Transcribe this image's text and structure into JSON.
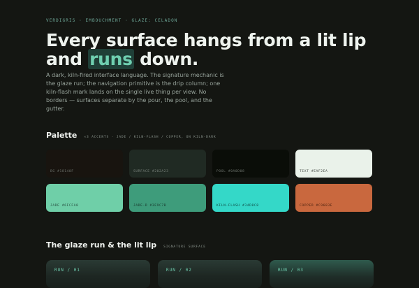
{
  "eyebrow": "VERDIGRIS · EMBOUCHMENT · GLAZE: CELADON",
  "headline": {
    "main": "Every surface hangs from a lit lip and ",
    "accent": "runs",
    "tail": " down."
  },
  "lede": "A dark, kiln-fired interface language. The signature mechanic is the glaze run; the navigation primitive is the drip column; one kiln-flash mark lands on the single live thing per view. No borders — surfaces separate by the pour, the pool, and the gutter.",
  "palette": {
    "title": "Palette",
    "subtitle": "×3 ACCENTS · JADE / KILN-FLASH / COPPER, ON KILN-DARK",
    "swatches": [
      {
        "label": "BG #18140F",
        "color": "#18140f",
        "text_color": "#6f756f"
      },
      {
        "label": "SURFACE #202A23",
        "color": "#202a23",
        "text_color": "#7c857e"
      },
      {
        "label": "POOL #0A0D08",
        "color": "#0a0d08",
        "text_color": "#6f756f"
      },
      {
        "label": "TEXT #EAF2EA",
        "color": "#eaf2ea",
        "text_color": "#3b413c"
      },
      {
        "label": "JADE #6FCFA8",
        "color": "#6fcfa8",
        "text_color": "#24493c"
      },
      {
        "label": "JADE-D #3E9C7B",
        "color": "#3e9c7b",
        "text_color": "#17342a"
      },
      {
        "label": "KILN-FLASH #34D8C8",
        "color": "#34d8c8",
        "text_color": "#0f4a44"
      },
      {
        "label": "COPPER #C9683E",
        "color": "#c9683e",
        "text_color": "#4a2210"
      }
    ]
  },
  "glaze": {
    "title": "The glaze run & the lit lip",
    "subtitle": "SIGNATURE SURFACE",
    "runs": [
      {
        "label": "RUN / 01"
      },
      {
        "label": "RUN / 02"
      },
      {
        "label": "RUN / 03"
      }
    ]
  }
}
